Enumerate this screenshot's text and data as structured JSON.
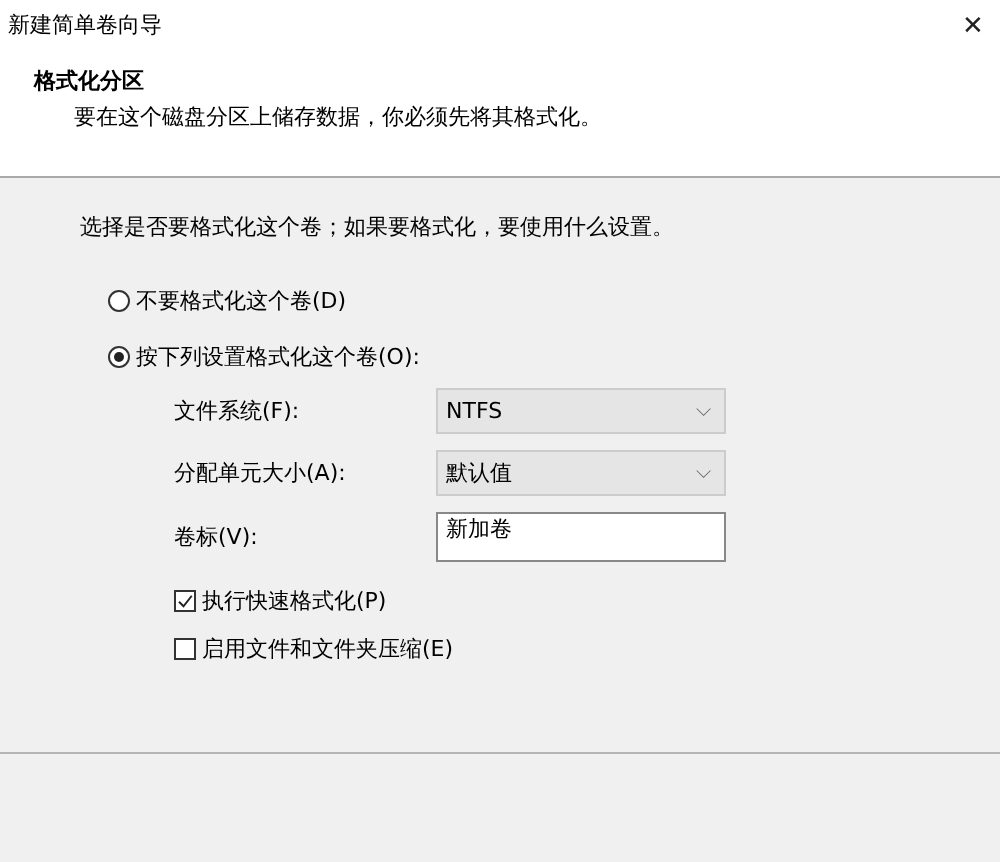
{
  "window": {
    "title": "新建简单卷向导",
    "close": "✕"
  },
  "header": {
    "title": "格式化分区",
    "subtitle": "要在这个磁盘分区上储存数据，你必须先将其格式化。"
  },
  "prompt": "选择是否要格式化这个卷；如果要格式化，要使用什么设置。",
  "options": [
    {
      "label": "不要格式化这个卷(D)",
      "selected": false
    },
    {
      "label": "按下列设置格式化这个卷(O):",
      "selected": true
    }
  ],
  "fields": [
    {
      "kind": "dropdown",
      "label": "文件系统(F):",
      "value": "NTFS",
      "caret": "⌵"
    },
    {
      "kind": "dropdown",
      "label": "分配单元大小(A):",
      "value": "默认值",
      "caret": "⌵"
    },
    {
      "kind": "text",
      "label": "卷标(V):",
      "value": "新加卷"
    }
  ],
  "checkboxes": [
    {
      "label": "执行快速格式化(P)",
      "checked": true
    },
    {
      "label": "启用文件和文件夹压缩(E)",
      "checked": false
    }
  ]
}
